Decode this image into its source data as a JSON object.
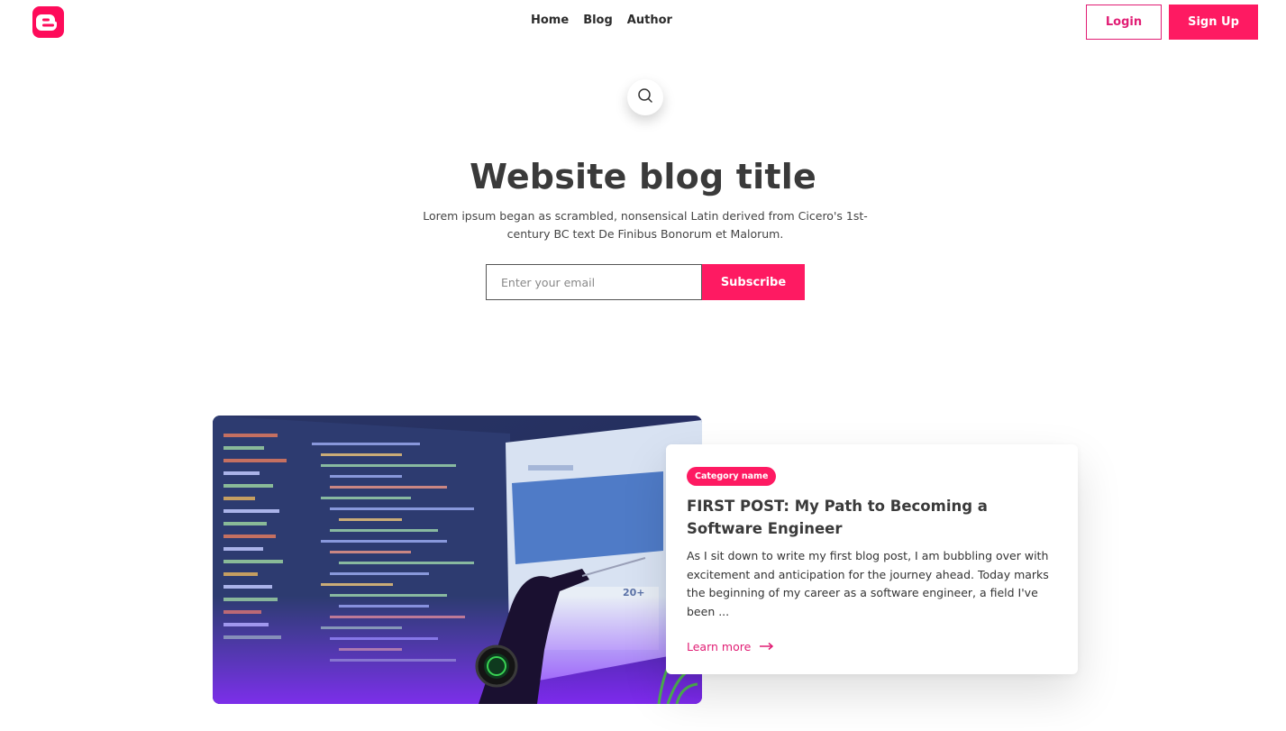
{
  "header": {
    "logo_icon": "blogger-logo-icon",
    "nav": [
      {
        "label": "Home"
      },
      {
        "label": "Blog"
      },
      {
        "label": "Author"
      }
    ],
    "login_label": "Login",
    "signup_label": "Sign Up"
  },
  "search": {
    "icon": "search-icon"
  },
  "hero": {
    "title": "Website blog title",
    "description": "Lorem ipsum began as scrambled, nonsensical Latin derived from Cicero's 1st-century BC text De Finibus Bonorum et Malorum.",
    "email_placeholder": "Enter your email",
    "subscribe_label": "Subscribe"
  },
  "post": {
    "category": "Category name",
    "title": "FIRST POST: My Path to Becoming a Software Engineer",
    "excerpt": "As I sit down to write my first blog post, I am bubbling over with excitement and anticipation for the journey ahead. Today marks the beginning of my career as a software engineer, a field I've been ...",
    "learn_more_label": "Learn more",
    "arrow_icon": "arrow-right-icon"
  },
  "colors": {
    "accent": "#fe1a62",
    "accent_dark": "#e11d74",
    "text": "#3a3a3a"
  }
}
